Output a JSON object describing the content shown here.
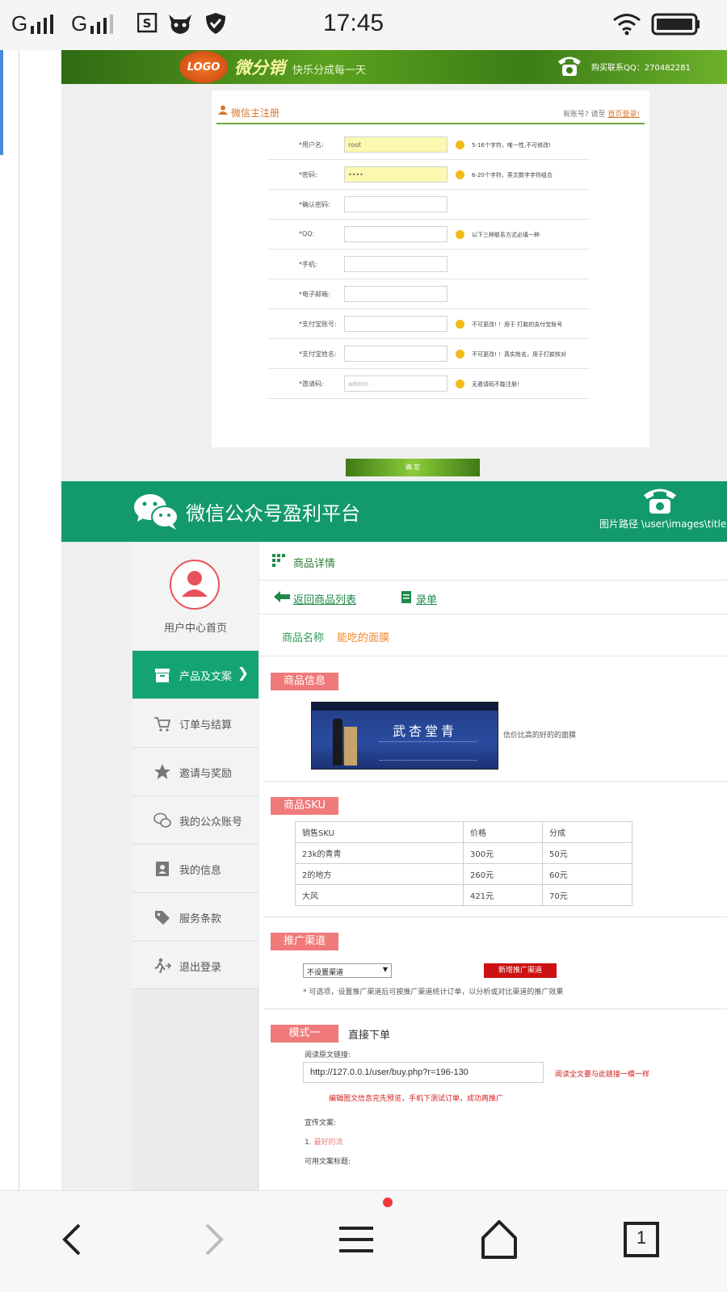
{
  "status_bar": {
    "signal_1": "G",
    "signal_2": "G",
    "time": "17:45"
  },
  "reg_page": {
    "logo_text": "LOGO",
    "brand": "微分销",
    "slogan": "快乐分成每一天",
    "qq_contact": "购买联系QQ：270482281",
    "title": "微信主注册",
    "login_prompt": "有账号? 请至",
    "login_link": "首页登录!",
    "fields": [
      {
        "label": "*用户名:",
        "value": "root",
        "hint": "5-16个字符，唯一性,不可修改!"
      },
      {
        "label": "*密码:",
        "value": "••••",
        "hint": "6-20个字符，英文数字字符组合"
      },
      {
        "label": "*确认密码:",
        "value": "",
        "hint": ""
      },
      {
        "label": "*QQ:",
        "value": "",
        "hint": "以下三种联系方式必填一种"
      },
      {
        "label": "*手机:",
        "value": "",
        "hint": ""
      },
      {
        "label": "*电子邮箱:",
        "value": "",
        "hint": ""
      },
      {
        "label": "*支付宝账号:",
        "value": "",
        "hint": "不可更改! ！用于 打款的支付宝账号"
      },
      {
        "label": "*支付宝姓名:",
        "value": "",
        "hint": "不可更改! ！真实姓名，用于打款核对"
      },
      {
        "label": "*邀请码:",
        "value": "admin",
        "hint": "无邀请码不能注册!"
      }
    ],
    "submit": "确 定"
  },
  "wx_page": {
    "title": "微信公众号盈利平台",
    "image_path": "图片路径 \\user\\images\\title.j",
    "sidebar": {
      "home": "用户中心首页",
      "items": [
        {
          "label": "产品及文案",
          "icon": "box-icon"
        },
        {
          "label": "订单与结算",
          "icon": "cart-icon"
        },
        {
          "label": "邀请与奖励",
          "icon": "star-icon"
        },
        {
          "label": "我的公众账号",
          "icon": "wechat-icon"
        },
        {
          "label": "我的信息",
          "icon": "contact-card-icon"
        },
        {
          "label": "服务条款",
          "icon": "tag-icon"
        },
        {
          "label": "退出登录",
          "icon": "logout-icon"
        }
      ],
      "active_chevron": "❯"
    },
    "breadcrumb": "商品详情",
    "back_link": "返回商品列表",
    "record_link": "录单",
    "product_name_label": "商品名称",
    "product_name": "能吃的面膜",
    "section_info": "商品信息",
    "product_desc": "信价比高的好的的面膜",
    "image_text": "武杏堂青",
    "section_sku": "商品SKU",
    "sku_table": {
      "headers": [
        "销售SKU",
        "价格",
        "分成"
      ],
      "rows": [
        [
          "23k的青青",
          "300元",
          "50元"
        ],
        [
          "2的地方",
          "260元",
          "60元"
        ],
        [
          "大风",
          "421元",
          "70元"
        ]
      ]
    },
    "section_channel": "推广渠道",
    "channel_select": "不设置渠道",
    "new_channel": "新增推广渠道",
    "channel_note": "* 可选项，设置推广渠道后可按推广渠道统计订单，以分析或对比渠道的推广效果",
    "mode_tag": "模式一",
    "mode_title": "直接下单",
    "read_link_label": "阅读原文链接:",
    "read_link": "http://127.0.0.1/user/buy.php?r=196-130",
    "read_link_note": "阅读全文要与此链接一模一样",
    "edit_note": "编辑图文信息完先预览，手机下测试订单，成功再推广",
    "promo_label": "宣传文案:",
    "promo_item_num": "1.",
    "promo_item": "最好的流",
    "title_label": "可用文案标题:"
  },
  "bottom_nav": {
    "tab_count": "1"
  },
  "colors": {
    "brand_green": "#139a6b",
    "active_sidebar": "#14a472",
    "tag_red": "#f07a7a",
    "alert_red": "#d21c1c"
  }
}
